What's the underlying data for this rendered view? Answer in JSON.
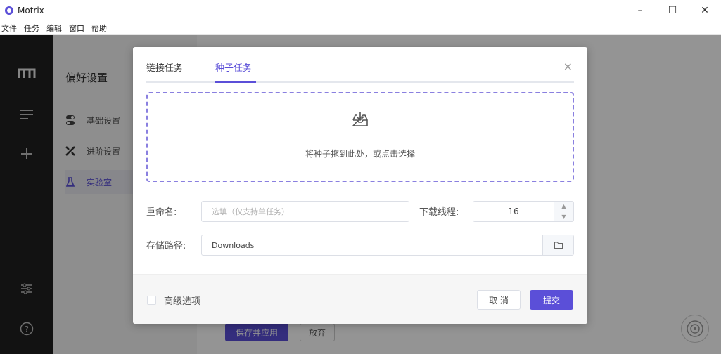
{
  "window": {
    "title": "Motrix",
    "controls": {
      "minimize": "–",
      "maximize": "☐",
      "close": "✕"
    }
  },
  "menu": [
    "文件",
    "任务",
    "编辑",
    "窗口",
    "帮助"
  ],
  "sidebar": {
    "icons": [
      "motrix-logo-icon",
      "menu-list-icon",
      "add-icon",
      "settings-sliders-icon",
      "help-icon"
    ]
  },
  "preferences": {
    "title": "偏好设置",
    "items": [
      {
        "label": "基础设置",
        "icon": "toggle-icon"
      },
      {
        "label": "进阶设置",
        "icon": "tools-icon"
      },
      {
        "label": "实验室",
        "icon": "flask-icon",
        "active": true
      }
    ],
    "save_label": "保存并应用",
    "discard_label": "放弃"
  },
  "dialog": {
    "tabs": [
      {
        "label": "链接任务",
        "active": false
      },
      {
        "label": "种子任务",
        "active": true
      }
    ],
    "close": "×",
    "dropzone": {
      "text": "将种子拖到此处，或点击选择",
      "icon": "tray-download-icon"
    },
    "rename": {
      "label": "重命名:",
      "placeholder": "选填（仅支持单任务）",
      "value": ""
    },
    "threads": {
      "label": "下载线程:",
      "value": "16"
    },
    "path": {
      "label": "存储路径:",
      "value": "Downloads"
    },
    "advanced_label": "高级选项",
    "cancel_label": "取 消",
    "submit_label": "提交"
  },
  "colors": {
    "accent": "#5b4fd8",
    "sidebar_bg": "#1f1f1f",
    "overlay": "rgba(0,0,0,0.42)"
  }
}
